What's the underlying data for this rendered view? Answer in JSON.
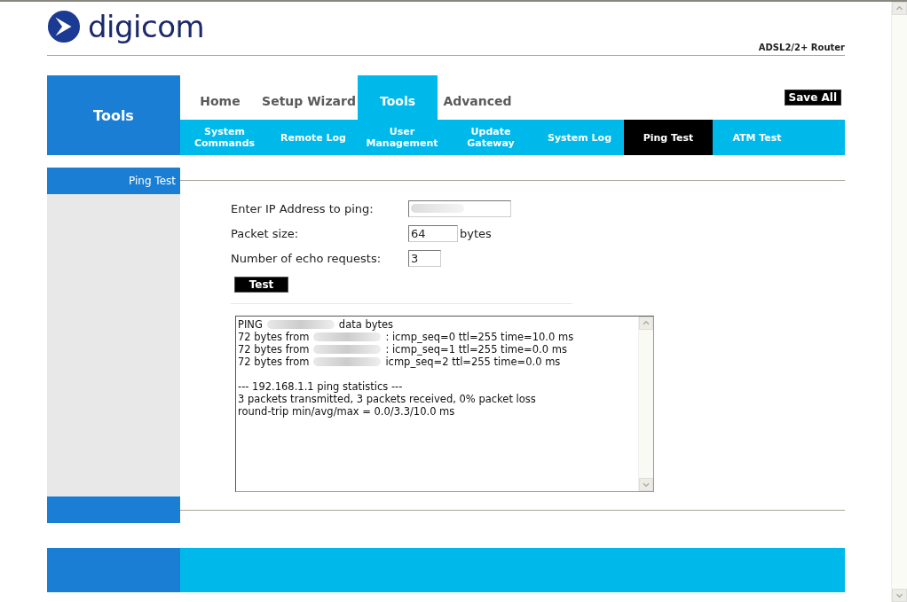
{
  "logo": {
    "text": "digicom"
  },
  "product": "ADSL2/2+ Router",
  "section_title": "Tools",
  "tabs": [
    {
      "label": "Home",
      "selected": false
    },
    {
      "label": "Setup Wizard",
      "selected": false
    },
    {
      "label": "Tools",
      "selected": true
    },
    {
      "label": "Advanced",
      "selected": false
    }
  ],
  "save_button": "Save All",
  "subtabs": [
    {
      "label": "System Commands",
      "selected": false
    },
    {
      "label": "Remote Log",
      "selected": false
    },
    {
      "label": "User Management",
      "selected": false
    },
    {
      "label": "Update Gateway",
      "selected": false
    },
    {
      "label": "System Log",
      "selected": false
    },
    {
      "label": "Ping Test",
      "selected": true
    },
    {
      "label": "ATM Test",
      "selected": false
    }
  ],
  "sidebar": {
    "heading": "Ping Test"
  },
  "form": {
    "fields": [
      {
        "label": "Enter IP Address to ping:",
        "redacted": true
      },
      {
        "label": "Packet size:",
        "value": "64",
        "redacted": false,
        "unit": "bytes"
      },
      {
        "label": "Number of echo requests:",
        "value": "3",
        "redacted": false
      }
    ],
    "button": "Test"
  },
  "output": {
    "lines": [
      {
        "start": "PING",
        "redacted": true,
        "end": "data bytes"
      },
      {
        "start": "72 bytes from",
        "redacted": true,
        "end": ": icmp_seq=0 ttl=255 time=10.0 ms"
      },
      {
        "start": "72 bytes from",
        "redacted": true,
        "end": ": icmp_seq=1 ttl=255 time=0.0 ms"
      },
      {
        "start": "72 bytes from",
        "redacted": true,
        "end": "icmp_seq=2 ttl=255 time=0.0 ms"
      },
      {
        "redacted": false
      },
      {
        "start": "--- 192.168.1.1 ping statistics ---",
        "redacted": false
      },
      {
        "start": "3 packets transmitted, 3 packets received, 0% packet loss",
        "redacted": false
      },
      {
        "start": "round-trip min/avg/max = 0.0/3.3/10.0 ms",
        "redacted": false
      }
    ]
  }
}
